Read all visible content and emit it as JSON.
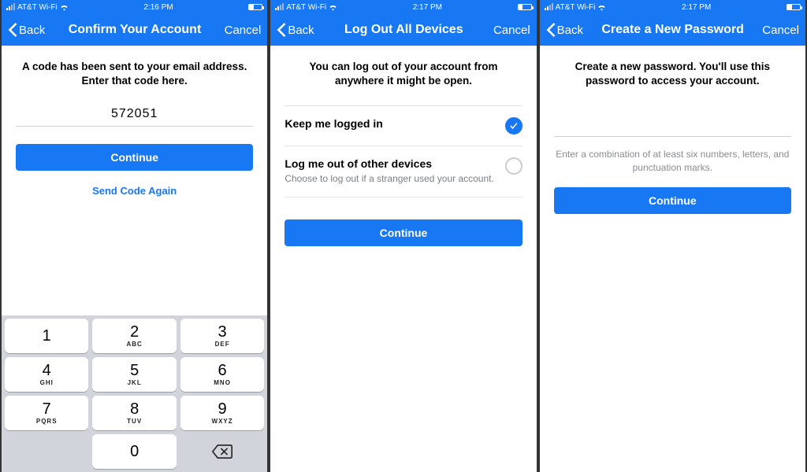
{
  "status": {
    "carrier": "AT&T Wi-Fi",
    "time_a": "2:16 PM",
    "time_b": "2:17 PM",
    "time_c": "2:17 PM"
  },
  "nav": {
    "back": "Back",
    "cancel": "Cancel",
    "title_a": "Confirm Your Account",
    "title_b": "Log Out All Devices",
    "title_c": "Create a New Password"
  },
  "screen1": {
    "prompt": "A code has been sent to your email address. Enter that code here.",
    "code": "572051",
    "continue": "Continue",
    "resend": "Send Code Again"
  },
  "screen2": {
    "prompt": "You can log out of your account from anywhere it might be open.",
    "opt1_title": "Keep me logged in",
    "opt2_title": "Log me out of other devices",
    "opt2_sub": "Choose to log out if a stranger used your account.",
    "continue": "Continue"
  },
  "screen3": {
    "prompt": "Create a new password. You'll use this password to access your account.",
    "hint": "Enter a combination of at least six numbers, letters, and punctuation marks.",
    "continue": "Continue"
  },
  "keypad": [
    {
      "n": "1",
      "l": ""
    },
    {
      "n": "2",
      "l": "ABC"
    },
    {
      "n": "3",
      "l": "DEF"
    },
    {
      "n": "4",
      "l": "GHI"
    },
    {
      "n": "5",
      "l": "JKL"
    },
    {
      "n": "6",
      "l": "MNO"
    },
    {
      "n": "7",
      "l": "PQRS"
    },
    {
      "n": "8",
      "l": "TUV"
    },
    {
      "n": "9",
      "l": "WXYZ"
    },
    {
      "n": "",
      "l": ""
    },
    {
      "n": "0",
      "l": ""
    },
    {
      "n": "del",
      "l": ""
    }
  ]
}
